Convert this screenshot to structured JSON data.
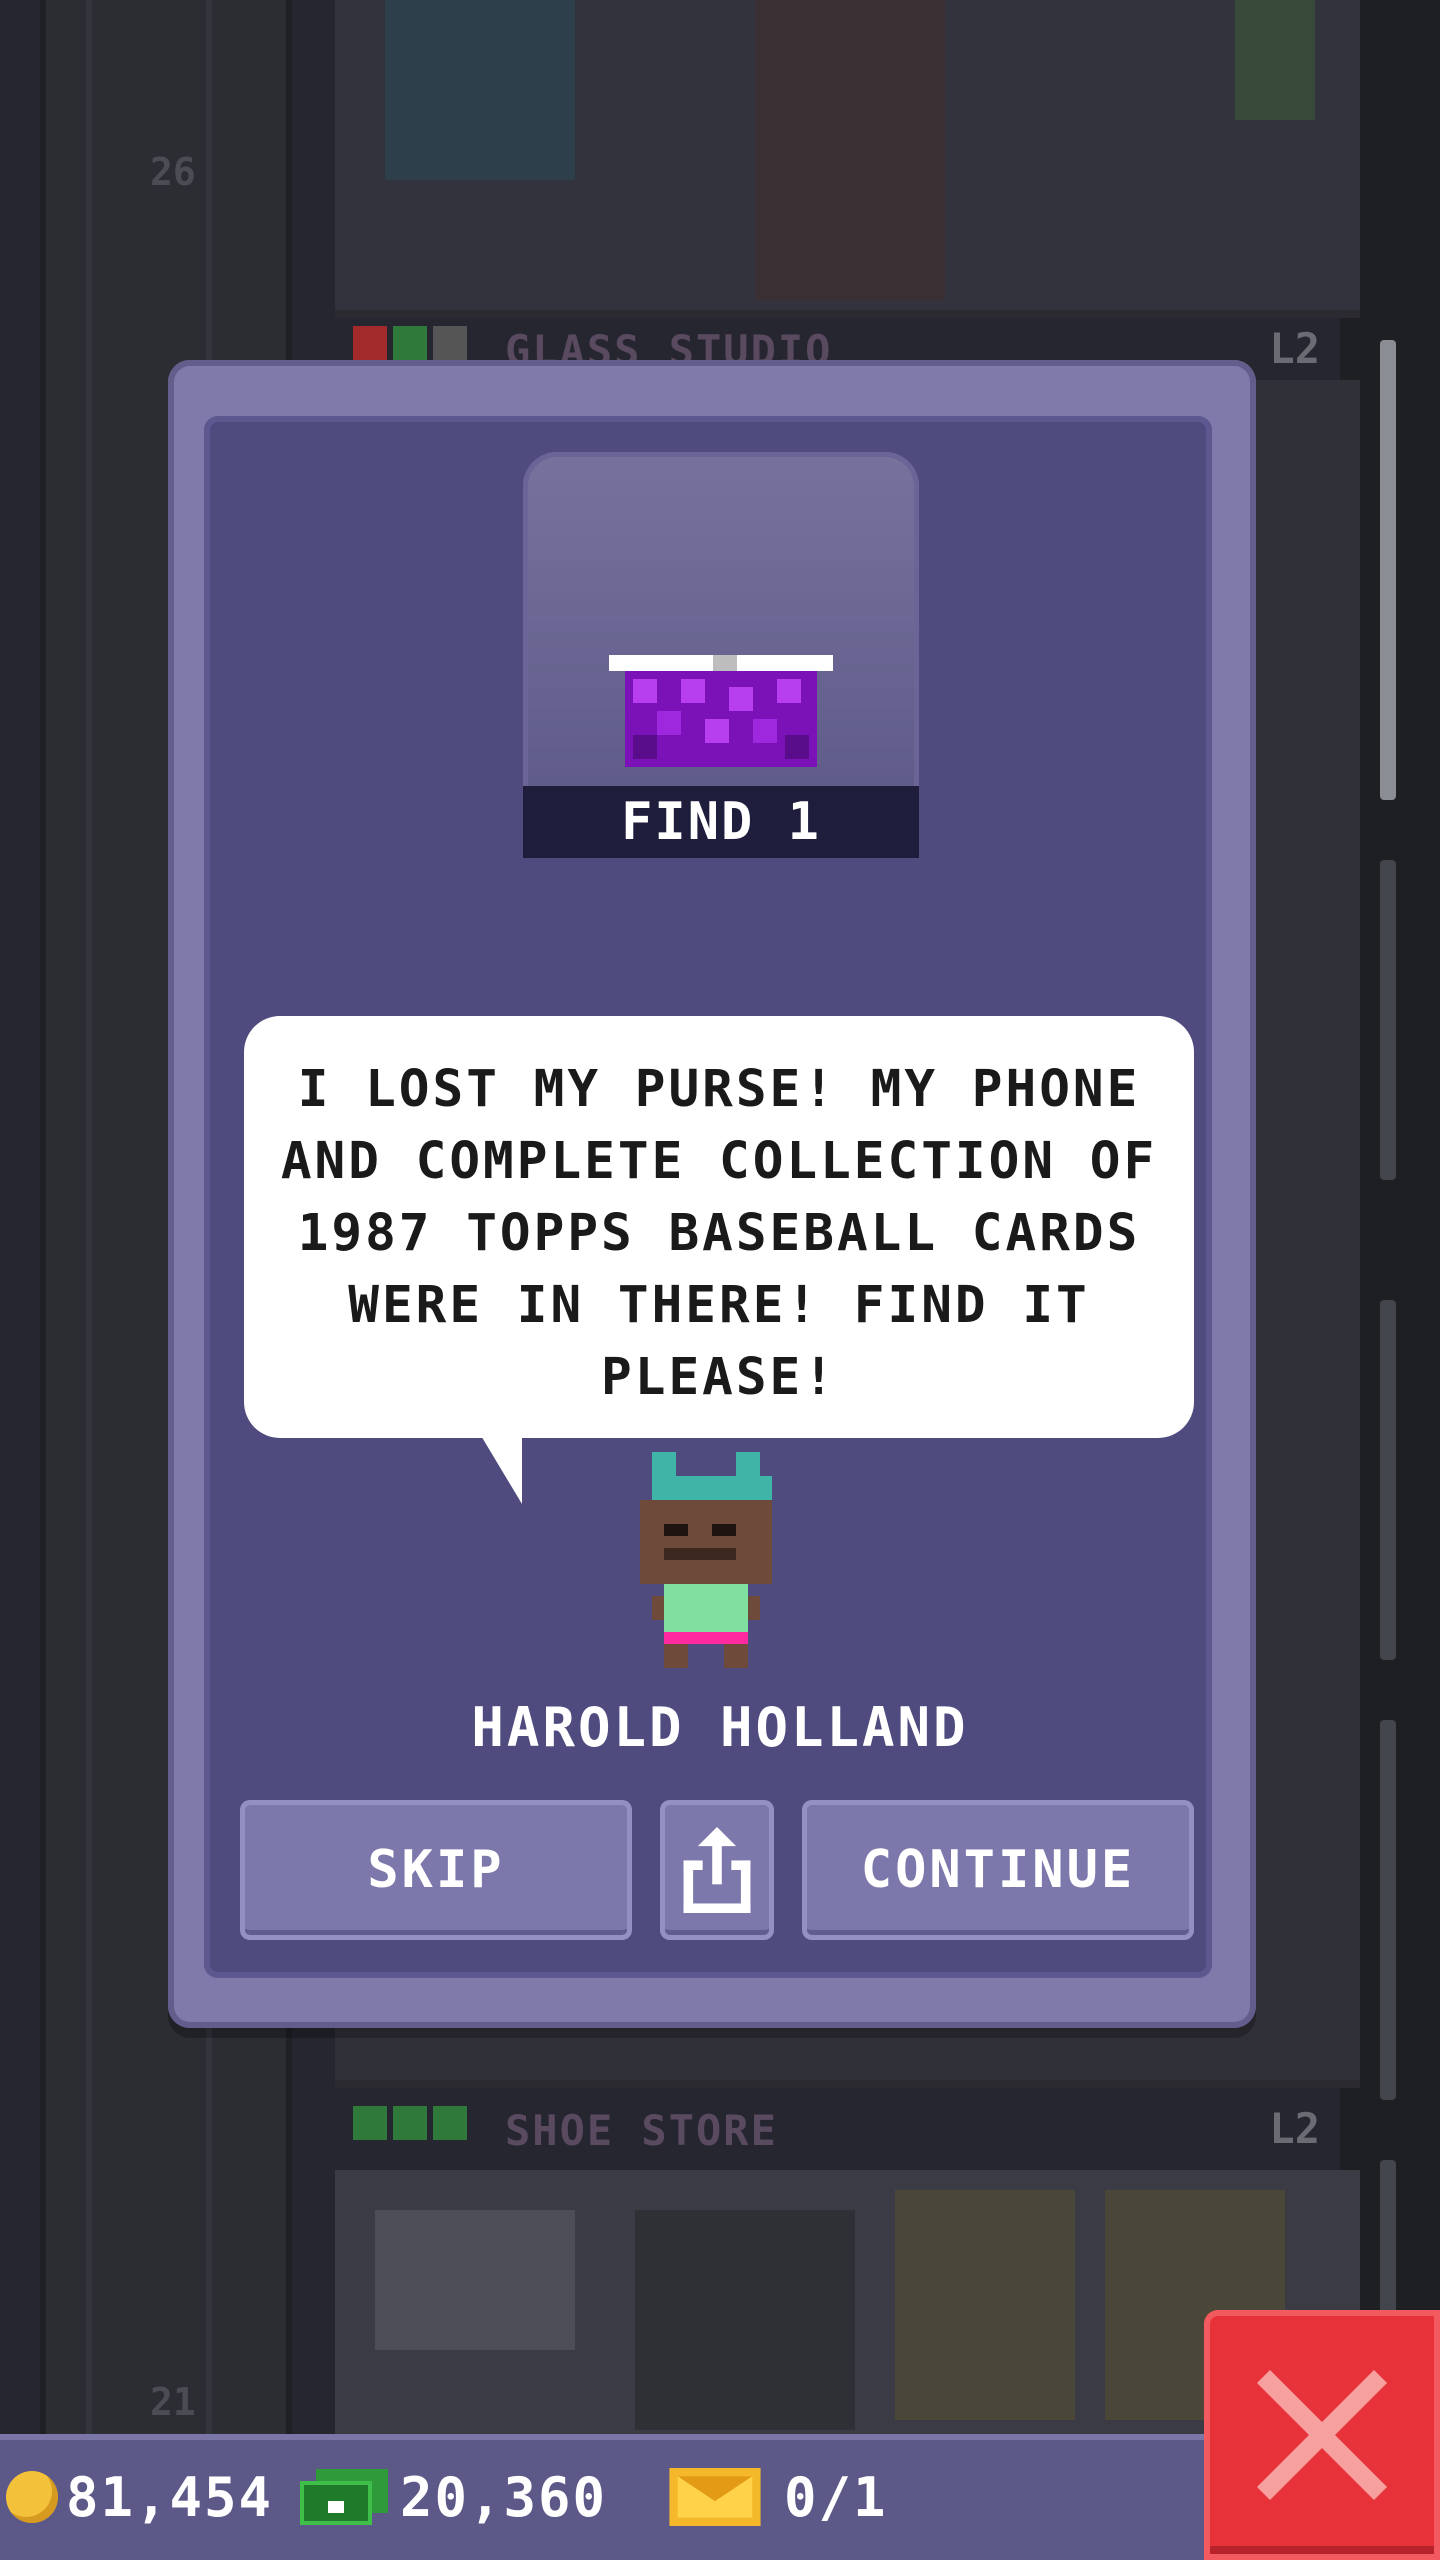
{
  "background": {
    "floor_numbers": [
      "26",
      "21"
    ],
    "floors": [
      {
        "name": "GLASS STUDIO",
        "level": "L2"
      },
      {
        "name": "SHOE STORE",
        "level": "L2"
      }
    ]
  },
  "dialog": {
    "item_status": "FIND 1",
    "item_icon": "purse-icon",
    "message": "I LOST MY PURSE! MY PHONE AND COMPLETE COLLECTION OF 1987 TOPPS BASEBALL CARDS WERE IN THERE! FIND IT PLEASE!",
    "character_name": "HAROLD HOLLAND",
    "buttons": {
      "skip": "SKIP",
      "share_icon": "share-icon",
      "continue": "CONTINUE"
    }
  },
  "hud": {
    "coins": "81,454",
    "bux": "20,360",
    "tickets": "0/1"
  },
  "colors": {
    "panel": "#7f7aaa",
    "panel_inner": "#4f4b7f",
    "button": "#7c78ac",
    "close": "#e8323a",
    "purse": "#8a18c8"
  }
}
